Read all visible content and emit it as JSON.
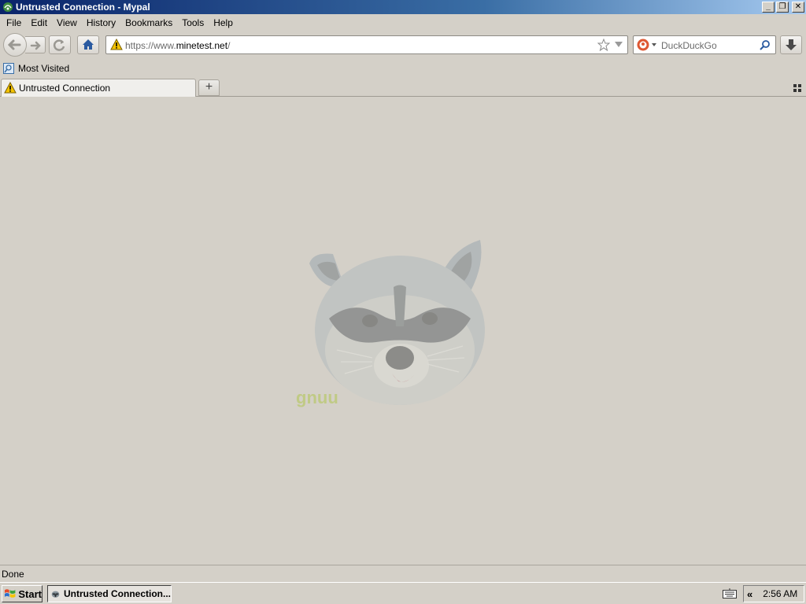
{
  "window": {
    "title": "Untrusted Connection - Mypal",
    "controls": [
      "minimize",
      "restore",
      "close"
    ]
  },
  "menubar": {
    "items": [
      {
        "label": "File"
      },
      {
        "label": "Edit"
      },
      {
        "label": "View"
      },
      {
        "label": "History"
      },
      {
        "label": "Bookmarks"
      },
      {
        "label": "Tools"
      },
      {
        "label": "Help"
      }
    ]
  },
  "navbar": {
    "url_prefix": "https://www.",
    "url_host": "minetest.net",
    "url_suffix": "/",
    "search_placeholder": "DuckDuckGo"
  },
  "bookmarks": {
    "items": [
      {
        "label": "Most Visited",
        "icon": "most-visited-icon"
      }
    ]
  },
  "tabs": {
    "items": [
      {
        "label": "Untrusted Connection",
        "icon": "warning-icon",
        "active": true
      }
    ],
    "new_tab_label": "+"
  },
  "content": {
    "watermark_text": "gnuu"
  },
  "status": {
    "text": "Done"
  },
  "taskbar": {
    "start_label": "Start",
    "task_label": "Untrusted Connection...",
    "tray_chevron": "«",
    "clock": "2:56 AM"
  },
  "colors": {
    "titlebar_start": "#0a246a",
    "titlebar_end": "#a6caf0",
    "chrome_bg": "#d4d0c8",
    "warning": "#f5c400"
  }
}
